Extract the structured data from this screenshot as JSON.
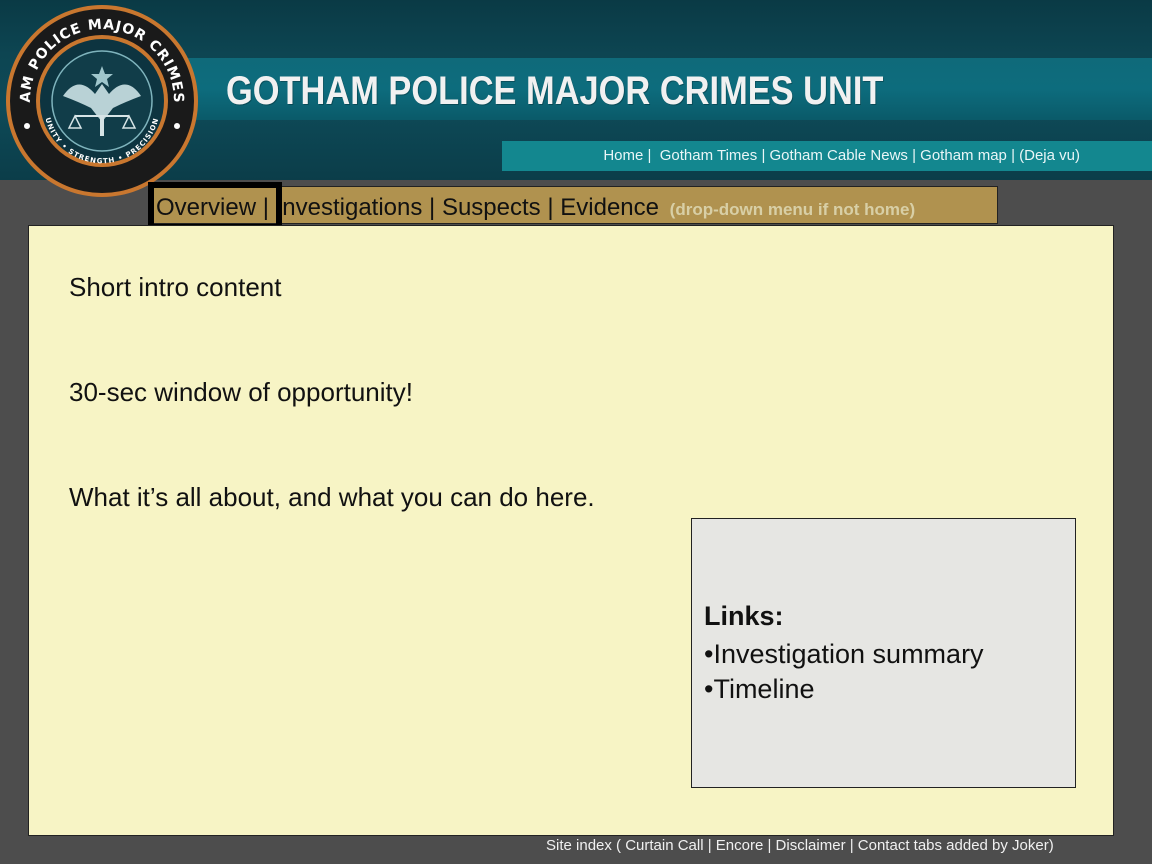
{
  "header": {
    "title": "GOTHAM POLICE MAJOR CRIMES UNIT",
    "badge": {
      "top_text": "GOTHAM POLICE MAJOR CRIMES UNIT",
      "bottom_text": "UNITY • STRENGTH • PRECISION",
      "icon": "eagle-scales-emblem"
    },
    "nav": {
      "items": [
        "Home |",
        "Gotham Times",
        "|",
        "Gotham Cable News",
        "|",
        "Gotham map",
        "|",
        "(Deja vu)"
      ]
    }
  },
  "tabs": {
    "items": [
      "Overview",
      "|",
      "Investigations",
      "|",
      "Suspects",
      "|",
      "Evidence"
    ],
    "note": "(drop-down menu if not home)",
    "active": "Overview"
  },
  "content": {
    "lines": [
      "Short intro content",
      "30-sec window of opportunity!",
      "What it’s all about, and what you can do here."
    ],
    "links_box": {
      "title": "Links:",
      "items": [
        "•Investigation summary",
        "•Timeline"
      ]
    }
  },
  "footer": {
    "text": "Site index ( Curtain Call | Encore | Disclaimer | Contact tabs added by Joker)"
  },
  "colors": {
    "background": "#4d4d4d",
    "header_dark": "#0d4552",
    "header_band": "#0d6c7d",
    "nav_bar": "#13878f",
    "tabs_bar": "#b0924f",
    "content_bg": "#f7f4c5",
    "links_box_bg": "#e6e6e3"
  }
}
